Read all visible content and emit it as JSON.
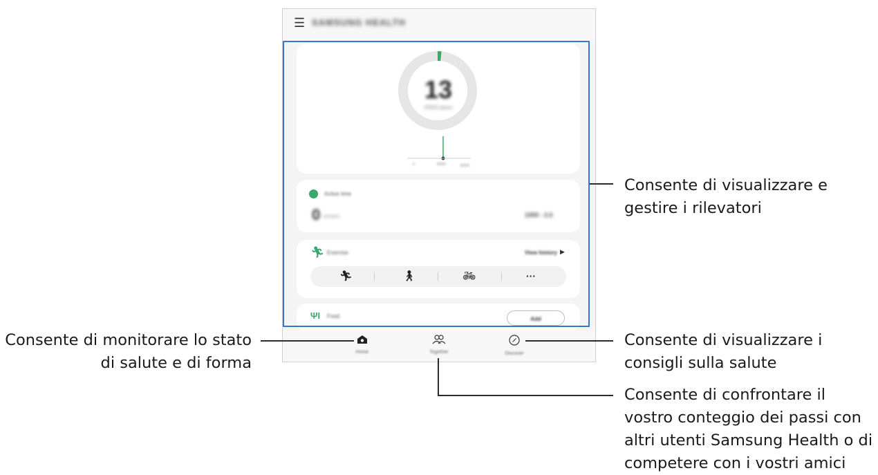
{
  "app": {
    "title": "SAMSUNG HEALTH",
    "menu_icon": "hamburger-menu-icon"
  },
  "steps_card": {
    "count": "13",
    "caption": "/6000 passi",
    "scale_left": "0",
    "scale_mid": "6000",
    "scale_right": "6000"
  },
  "active_time": {
    "title": "Active time",
    "value": "0",
    "unit": "minutes",
    "right_value": "1000 - 2.0"
  },
  "exercise": {
    "title": "Exercise",
    "link": "View history",
    "more": "···"
  },
  "food": {
    "title": "Food",
    "button": "Add"
  },
  "nav": [
    {
      "label": "Home",
      "icon": "home-icon"
    },
    {
      "label": "Together",
      "icon": "people-icon"
    },
    {
      "label": "Discover",
      "icon": "compass-icon"
    }
  ],
  "callouts": {
    "trackers": [
      "Consente di visualizzare e",
      "gestire i rilevatori"
    ],
    "home": [
      "Consente di monitorare lo stato",
      "di salute e di forma"
    ],
    "discover": [
      "Consente di visualizzare i",
      "consigli sulla salute"
    ],
    "together": [
      "Consente di confrontare il",
      "vostro conteggio dei passi con",
      "altri utenti Samsung Health o di",
      "competere con i vostri amici"
    ]
  },
  "colors": {
    "highlight": "#2f79c6",
    "green": "#3aa76d"
  }
}
